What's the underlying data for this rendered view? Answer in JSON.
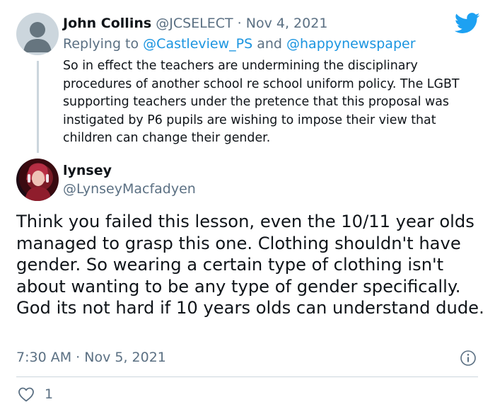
{
  "quoted_tweet": {
    "author_name": "John Collins",
    "author_handle": "@JCSELECT",
    "separator": "·",
    "date": "Nov 4, 2021",
    "replying_prefix": "Replying to",
    "reply_to_1": "@Castleview_PS",
    "reply_and": "and",
    "reply_to_2": "@happynewspaper",
    "text": "So in effect the teachers are undermining the disciplinary procedures of another school re school uniform policy. The LGBT supporting teachers under the pretence that this proposal was instigated by P6 pupils are wishing to impose their view that children can change their gender."
  },
  "main_tweet": {
    "author_name": "lynsey",
    "author_handle": "@LynseyMacfadyen",
    "text": "Think you failed this lesson, even the 10/11 year olds managed to grasp this one. Clothing shouldn't have gender. So wearing a certain type of clothing isn't about wanting to be any type of gender specifically. God its not hard if 10 years olds can understand dude.",
    "time": "7:30 AM",
    "separator": "·",
    "date": "Nov 5, 2021",
    "like_count": "1"
  },
  "icons": {
    "brand": "twitter-bird-icon",
    "info": "info-icon",
    "like": "heart-icon"
  },
  "colors": {
    "twitter_blue": "#1da1f2",
    "link_blue": "#1b95e0",
    "muted_text": "#5b7083",
    "thread_line": "#ccd6dd"
  }
}
